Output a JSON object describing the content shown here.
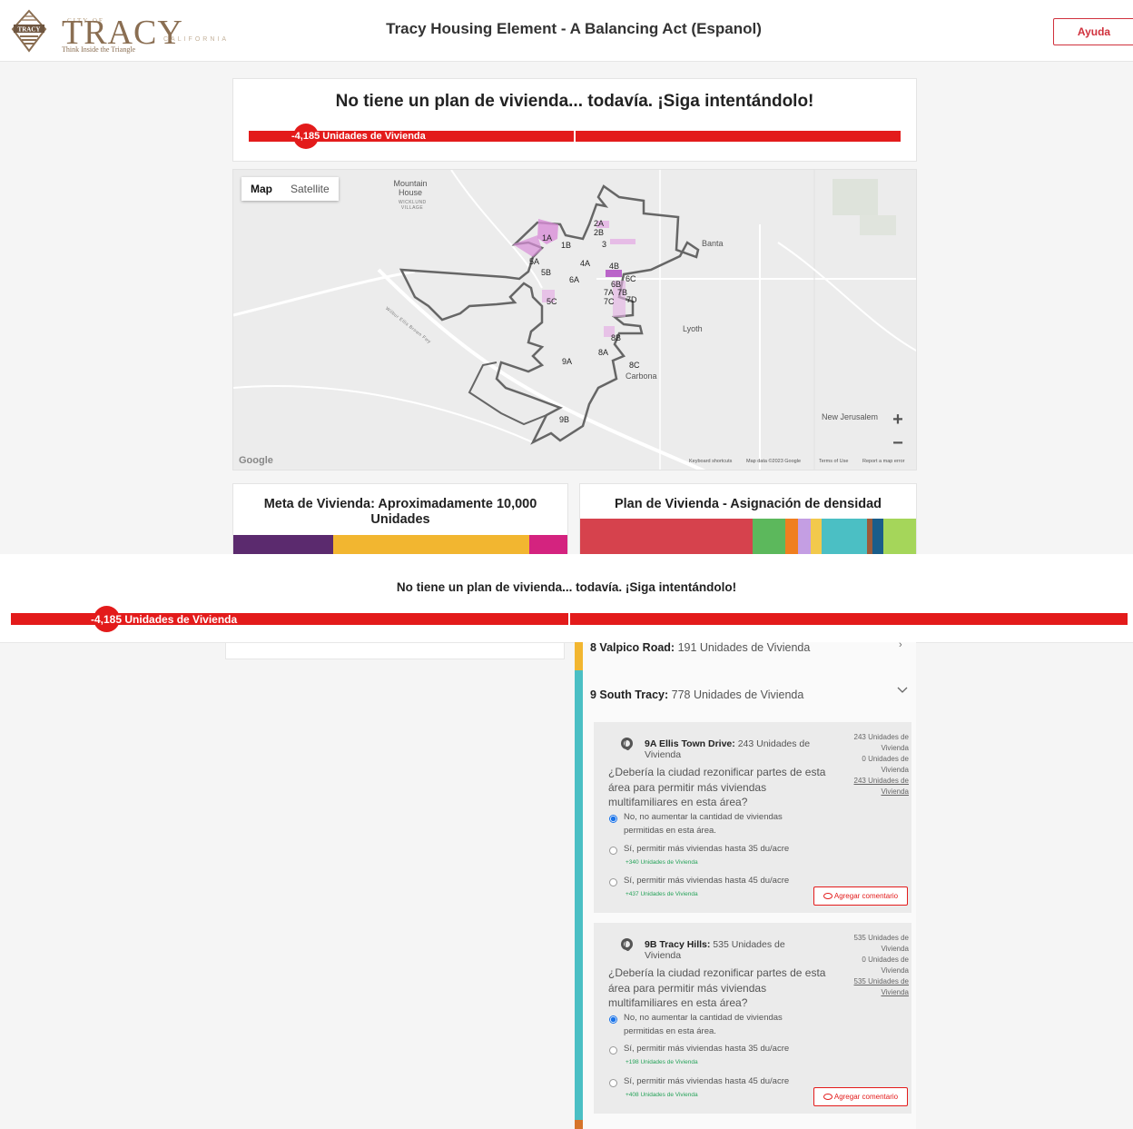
{
  "header": {
    "logo": {
      "city_of": "CITY OF",
      "name": "TRACY",
      "state": "CALIFORNIA",
      "tagline": "Think Inside the Triangle",
      "emblem_text": "TRACY"
    },
    "title": "Tracy Housing Element - A Balancing Act (Espanol)",
    "help_label": "Ayuda"
  },
  "status": {
    "heading": "No tiene un plan de vivienda... todavía. ¡Siga intentándolo!",
    "units_label": "-4,185 Unidades de Vivienda",
    "bar_color": "#e31b1b"
  },
  "map": {
    "type_buttons": [
      "Map",
      "Satellite"
    ],
    "active_type": "Map",
    "places": {
      "mountain_house": "Mountain House",
      "wicklund": "WICKLUND VILLAGE",
      "banta": "Banta",
      "lyoth": "Lyoth",
      "carbona": "Carbona",
      "new_jerusalem": "New Jerusalem",
      "freeway": "Wilbur Ellis Brown Fwy"
    },
    "zones": [
      "1A",
      "1B",
      "2A",
      "2B",
      "3",
      "4A",
      "4B",
      "5A",
      "5B",
      "5C",
      "6A",
      "6B",
      "6C",
      "7A",
      "7B",
      "7C",
      "7D",
      "8A",
      "8B",
      "8C",
      "9A",
      "9B"
    ],
    "google_label": "Google",
    "attribution": [
      "Keyboard shortcuts",
      "Map data ©2023 Google",
      "Terms of Use",
      "Report a map error"
    ],
    "zoom_in": "+",
    "zoom_out": "−"
  },
  "goal_card": {
    "title": "Meta de Vivienda: Aproximadamente 10,000 Unidades",
    "segment_colors": [
      "#5b2a6e",
      "#f2b630",
      "#d4237f"
    ]
  },
  "plan_card": {
    "title": "Plan de Vivienda - Asignación de densidad",
    "segment_colors": [
      "#d6424d",
      "#5cb85c",
      "#f07f1f",
      "#c49ee3",
      "#f2c94c",
      "#4bbfc4",
      "#9b5b3b",
      "#1a5d8a",
      "#a5d65a"
    ]
  },
  "lower": {
    "heading": "No tiene un plan de vivienda... todavía. ¡Siga intentándolo!",
    "units_label": "-4,185 Unidades de Vivienda"
  },
  "categories": [
    {
      "name": "8 Valpico Road:",
      "units": "191 Unidades de Vivienda",
      "color": "#f2b630"
    },
    {
      "name": "9 South Tracy:",
      "units": "778 Unidades de Vivienda",
      "color": "#4bbfc4"
    }
  ],
  "sites": [
    {
      "name": "9A Ellis Town Drive:",
      "units": "243 Unidades de Vivienda",
      "calc": [
        "243 Unidades de Vivienda",
        "0 Unidades de Vivienda",
        "243 Unidades de Vivienda"
      ],
      "question": "¿Debería la ciudad rezonificar partes de esta área para permitir más viviendas multifamiliares en esta área?",
      "options": [
        {
          "label": "No, no aumentar la cantidad de viviendas permitidas en esta área.",
          "delta": "",
          "selected": true
        },
        {
          "label": "Sí, permitir más viviendas hasta 35 du/acre",
          "delta": "+340 Unidades de Vivienda",
          "selected": false
        },
        {
          "label": "Sí, permitir más viviendas hasta 45 du/acre",
          "delta": "+437 Unidades de Vivienda",
          "selected": false
        }
      ],
      "comment_label": "Agregar comentario"
    },
    {
      "name": "9B Tracy Hills:",
      "units": "535 Unidades de Vivienda",
      "calc": [
        "535 Unidades de Vivienda",
        "0 Unidades de Vivienda",
        "535 Unidades de Vivienda"
      ],
      "question": "¿Debería la ciudad rezonificar partes de esta área para permitir más viviendas multifamiliares en esta área?",
      "options": [
        {
          "label": "No, no aumentar la cantidad de viviendas permitidas en esta área.",
          "delta": "",
          "selected": true
        },
        {
          "label": "Sí, permitir más viviendas hasta 35 du/acre",
          "delta": "+198 Unidades de Vivienda",
          "selected": false
        },
        {
          "label": "Sí, permitir más viviendas hasta 45 du/acre",
          "delta": "+408 Unidades de Vivienda",
          "selected": false
        }
      ],
      "comment_label": "Agregar comentario"
    }
  ]
}
